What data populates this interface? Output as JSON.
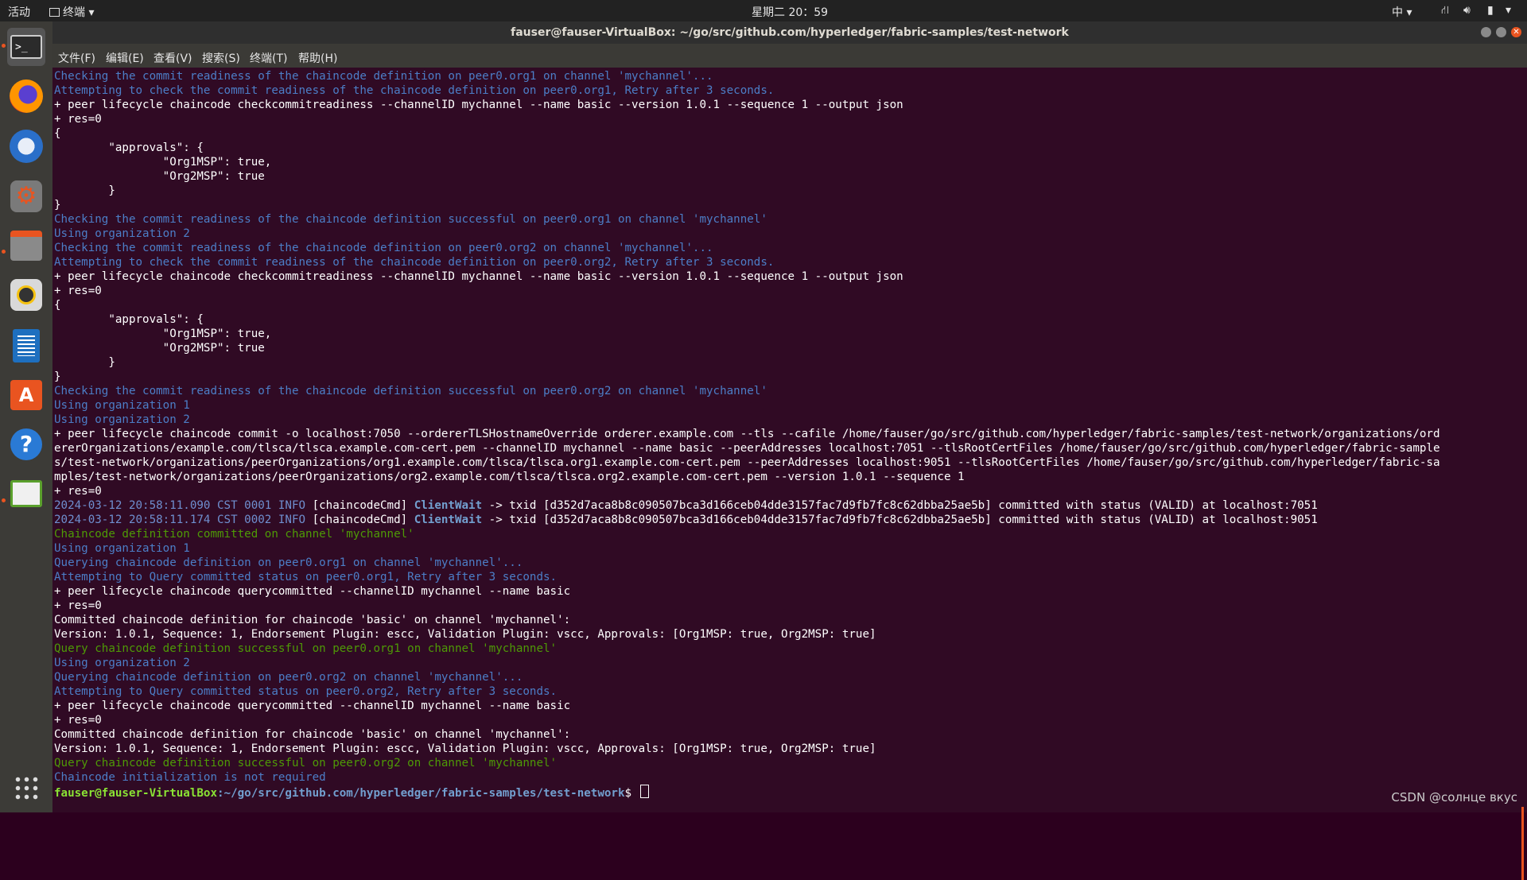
{
  "topbar": {
    "activities": "活动",
    "app_name": "终端",
    "clock": "星期二 20：59",
    "input_method": "中"
  },
  "window": {
    "title": "fauser@fauser-VirtualBox: ~/go/src/github.com/hyperledger/fabric-samples/test-network"
  },
  "menu": {
    "file": "文件(F)",
    "edit": "编辑(E)",
    "view": "查看(V)",
    "search": "搜索(S)",
    "terminal": "终端(T)",
    "help": "帮助(H)"
  },
  "dock": {
    "items": [
      "terminal-icon",
      "firefox-icon",
      "thunderbird-icon",
      "settings-icon",
      "files-icon",
      "rhythmbox-icon",
      "writer-icon",
      "software-icon",
      "help-icon",
      "screenshot-icon",
      "app-grid-icon"
    ]
  },
  "terminal": {
    "lines": [
      "Checking the commit readiness of the chaincode definition on peer0.org1 on channel 'mychannel'...",
      "Attempting to check the commit readiness of the chaincode definition on peer0.org1, Retry after 3 seconds.",
      "+ peer lifecycle chaincode checkcommitreadiness --channelID mychannel --name basic --version 1.0.1 --sequence 1 --output json",
      "+ res=0",
      "{",
      "        \"approvals\": {",
      "                \"Org1MSP\": true,",
      "                \"Org2MSP\": true",
      "        }",
      "}",
      "Checking the commit readiness of the chaincode definition successful on peer0.org1 on channel 'mychannel'",
      "Using organization 2",
      "Checking the commit readiness of the chaincode definition on peer0.org2 on channel 'mychannel'...",
      "Attempting to check the commit readiness of the chaincode definition on peer0.org2, Retry after 3 seconds.",
      "+ peer lifecycle chaincode checkcommitreadiness --channelID mychannel --name basic --version 1.0.1 --sequence 1 --output json",
      "+ res=0",
      "{",
      "        \"approvals\": {",
      "                \"Org1MSP\": true,",
      "                \"Org2MSP\": true",
      "        }",
      "}",
      "Checking the commit readiness of the chaincode definition successful on peer0.org2 on channel 'mychannel'",
      "Using organization 1",
      "Using organization 2",
      "+ peer lifecycle chaincode commit -o localhost:7050 --ordererTLSHostnameOverride orderer.example.com --tls --cafile /home/fauser/go/src/github.com/hyperledger/fabric-samples/test-network/organizations/ord",
      "ererOrganizations/example.com/tlsca/tlsca.example.com-cert.pem --channelID mychannel --name basic --peerAddresses localhost:7051 --tlsRootCertFiles /home/fauser/go/src/github.com/hyperledger/fabric-sample",
      "s/test-network/organizations/peerOrganizations/org1.example.com/tlsca/tlsca.org1.example.com-cert.pem --peerAddresses localhost:9051 --tlsRootCertFiles /home/fauser/go/src/github.com/hyperledger/fabric-sa",
      "mples/test-network/organizations/peerOrganizations/org2.example.com/tlsca/tlsca.org2.example.com-cert.pem --version 1.0.1 --sequence 1",
      "+ res=0",
      "2024-03-12 20:58:11.090 CST 0001 INFO [chaincodeCmd] ClientWait -> txid [d352d7aca8b8c090507bca3d166ceb04dde3157fac7d9fb7fc8c62dbba25ae5b] committed with status (VALID) at localhost:7051",
      "2024-03-12 20:58:11.174 CST 0002 INFO [chaincodeCmd] ClientWait -> txid [d352d7aca8b8c090507bca3d166ceb04dde3157fac7d9fb7fc8c62dbba25ae5b] committed with status (VALID) at localhost:9051",
      "Chaincode definition committed on channel 'mychannel'",
      "Using organization 1",
      "Querying chaincode definition on peer0.org1 on channel 'mychannel'...",
      "Attempting to Query committed status on peer0.org1, Retry after 3 seconds.",
      "+ peer lifecycle chaincode querycommitted --channelID mychannel --name basic",
      "+ res=0",
      "Committed chaincode definition for chaincode 'basic' on channel 'mychannel':",
      "Version: 1.0.1, Sequence: 1, Endorsement Plugin: escc, Validation Plugin: vscc, Approvals: [Org1MSP: true, Org2MSP: true]",
      "Query chaincode definition successful on peer0.org1 on channel 'mychannel'",
      "Using organization 2",
      "Querying chaincode definition on peer0.org2 on channel 'mychannel'...",
      "Attempting to Query committed status on peer0.org2, Retry after 3 seconds.",
      "+ peer lifecycle chaincode querycommitted --channelID mychannel --name basic",
      "+ res=0",
      "Committed chaincode definition for chaincode 'basic' on channel 'mychannel':",
      "Version: 1.0.1, Sequence: 1, Endorsement Plugin: escc, Validation Plugin: vscc, Approvals: [Org1MSP: true, Org2MSP: true]",
      "Query chaincode definition successful on peer0.org2 on channel 'mychannel'",
      "Chaincode initialization is not required"
    ],
    "line_colors": [
      "blue",
      "blue",
      "white",
      "white",
      "white",
      "white",
      "white",
      "white",
      "white",
      "white",
      "blue",
      "blue",
      "blue",
      "blue",
      "white",
      "white",
      "white",
      "white",
      "white",
      "white",
      "white",
      "white",
      "blue",
      "blue",
      "blue",
      "white",
      "white",
      "white",
      "white",
      "white",
      "log",
      "log",
      "green",
      "blue",
      "blue",
      "blue",
      "white",
      "white",
      "white",
      "white",
      "green",
      "blue",
      "blue",
      "blue",
      "white",
      "white",
      "white",
      "white",
      "green",
      "blue"
    ],
    "prompt_user": "fauser@fauser-VirtualBox",
    "prompt_path": ":~/go/src/github.com/hyperledger/fabric-samples/test-network",
    "prompt_symbol": "$ "
  },
  "watermark": "CSDN @солнце вкус",
  "colors": {
    "terminal_bg": "#300a24",
    "info_blue": "#4c7ec7",
    "success_green": "#4e9a06",
    "accent": "#e95420"
  }
}
